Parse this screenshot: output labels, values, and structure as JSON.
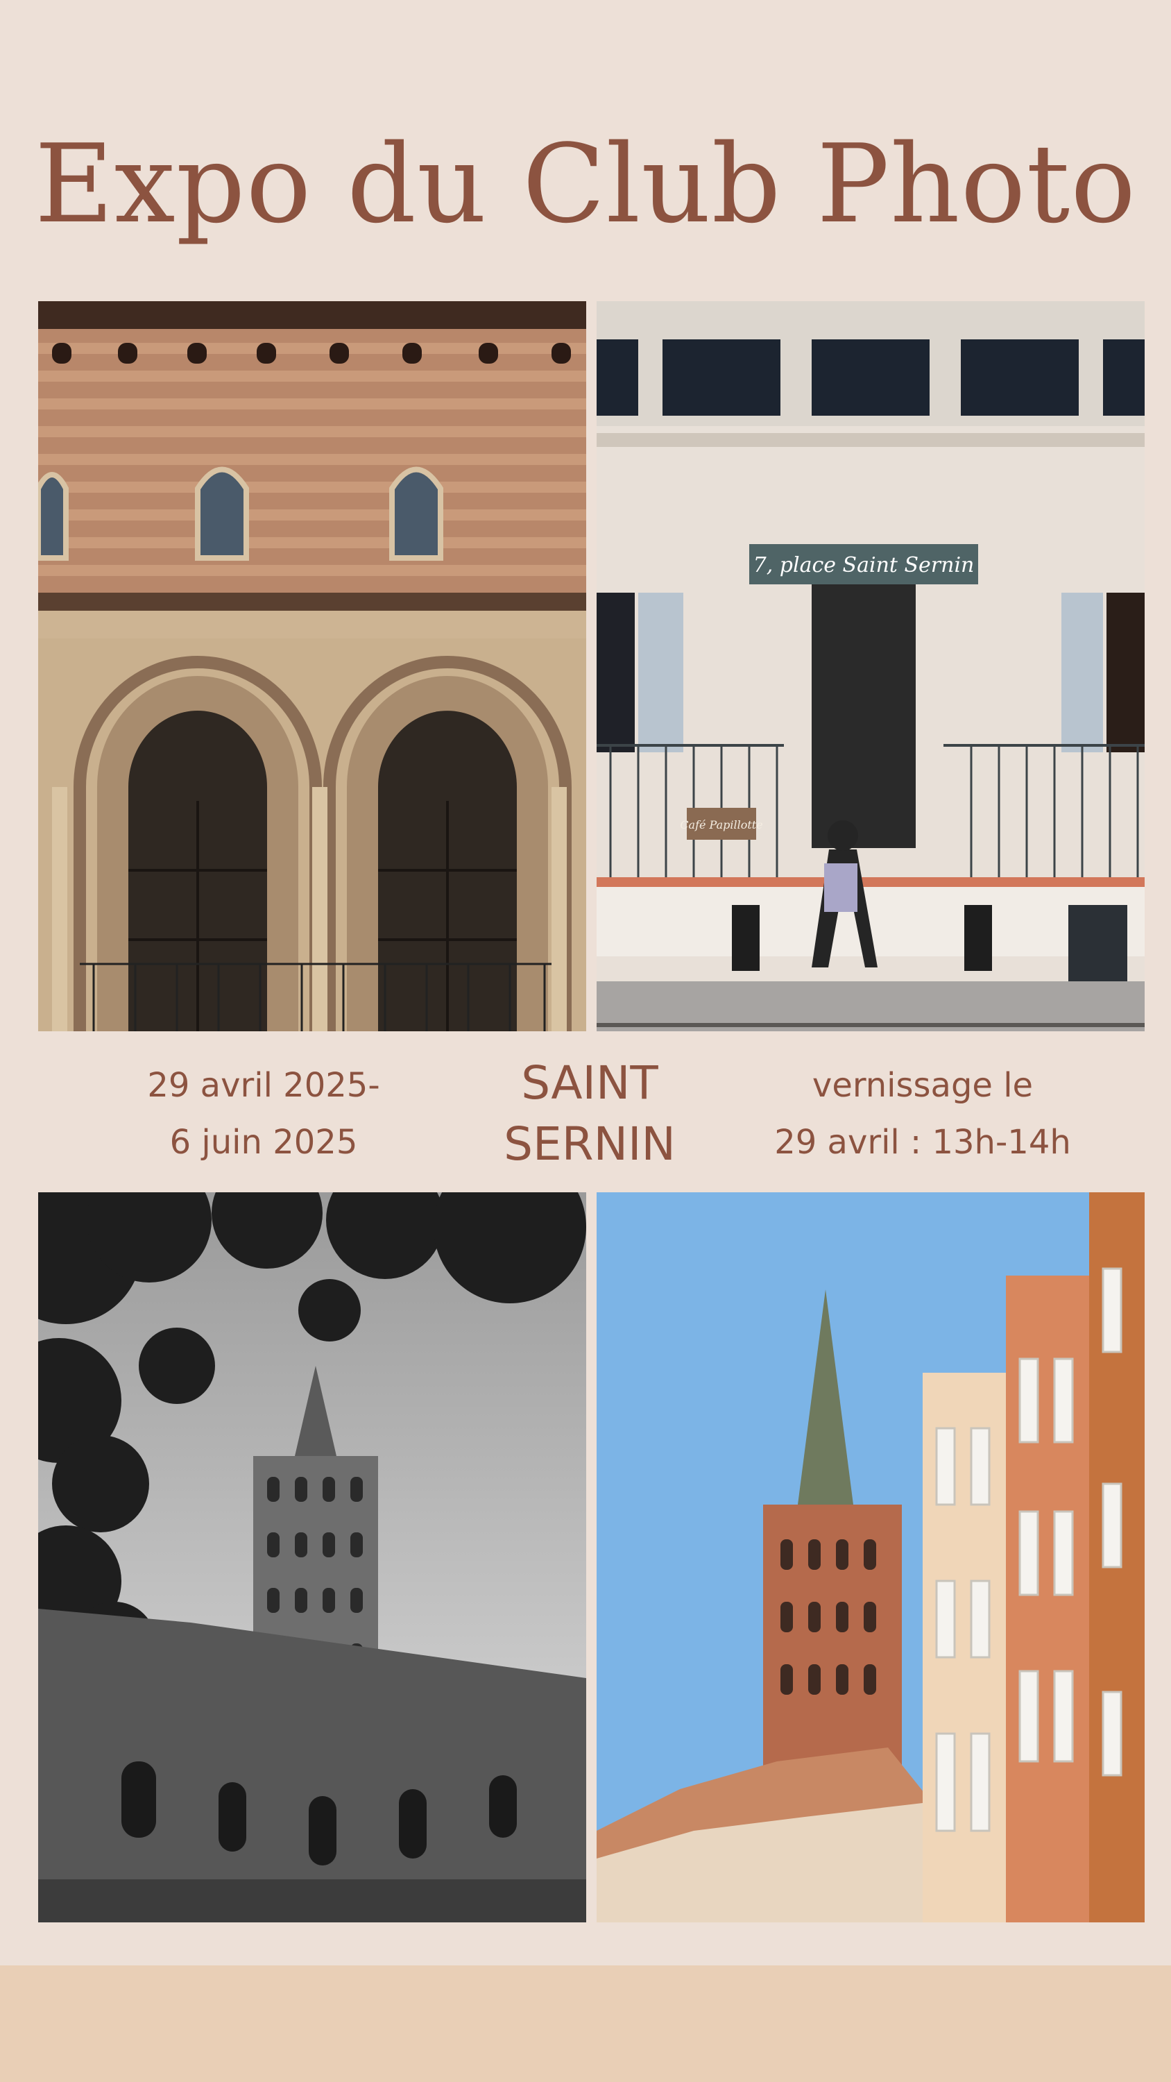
{
  "poster": {
    "title": "Expo du Club Photo",
    "dates": {
      "line1": "29 avril 2025-",
      "line2": "6 juin 2025"
    },
    "place": {
      "line1": "SAINT",
      "line2": "SERNIN"
    },
    "opening": {
      "line1": "vernissage le",
      "line2": "29 avril : 13h-14h"
    },
    "photos": [
      {
        "name": "basilica-portal-photo"
      },
      {
        "name": "place-saint-sernin-street-photo",
        "sign_text": "7, place Saint Sernin",
        "cafe_sign_text": "Café Papillotte"
      },
      {
        "name": "bell-tower-black-white-photo"
      },
      {
        "name": "bell-tower-blue-sky-photo"
      }
    ]
  },
  "colors": {
    "background": "#ede0d7",
    "text": "#8c5340",
    "footer_band": "#e9cfb6"
  }
}
